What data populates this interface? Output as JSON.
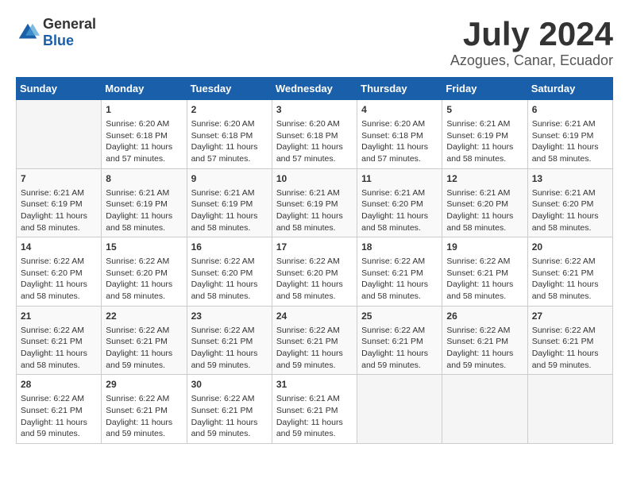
{
  "header": {
    "logo_general": "General",
    "logo_blue": "Blue",
    "month_year": "July 2024",
    "location": "Azogues, Canar, Ecuador"
  },
  "calendar": {
    "days_of_week": [
      "Sunday",
      "Monday",
      "Tuesday",
      "Wednesday",
      "Thursday",
      "Friday",
      "Saturday"
    ],
    "weeks": [
      [
        {
          "day": "",
          "info": ""
        },
        {
          "day": "1",
          "info": "Sunrise: 6:20 AM\nSunset: 6:18 PM\nDaylight: 11 hours\nand 57 minutes."
        },
        {
          "day": "2",
          "info": "Sunrise: 6:20 AM\nSunset: 6:18 PM\nDaylight: 11 hours\nand 57 minutes."
        },
        {
          "day": "3",
          "info": "Sunrise: 6:20 AM\nSunset: 6:18 PM\nDaylight: 11 hours\nand 57 minutes."
        },
        {
          "day": "4",
          "info": "Sunrise: 6:20 AM\nSunset: 6:18 PM\nDaylight: 11 hours\nand 57 minutes."
        },
        {
          "day": "5",
          "info": "Sunrise: 6:21 AM\nSunset: 6:19 PM\nDaylight: 11 hours\nand 58 minutes."
        },
        {
          "day": "6",
          "info": "Sunrise: 6:21 AM\nSunset: 6:19 PM\nDaylight: 11 hours\nand 58 minutes."
        }
      ],
      [
        {
          "day": "7",
          "info": "Sunrise: 6:21 AM\nSunset: 6:19 PM\nDaylight: 11 hours\nand 58 minutes."
        },
        {
          "day": "8",
          "info": "Sunrise: 6:21 AM\nSunset: 6:19 PM\nDaylight: 11 hours\nand 58 minutes."
        },
        {
          "day": "9",
          "info": "Sunrise: 6:21 AM\nSunset: 6:19 PM\nDaylight: 11 hours\nand 58 minutes."
        },
        {
          "day": "10",
          "info": "Sunrise: 6:21 AM\nSunset: 6:19 PM\nDaylight: 11 hours\nand 58 minutes."
        },
        {
          "day": "11",
          "info": "Sunrise: 6:21 AM\nSunset: 6:20 PM\nDaylight: 11 hours\nand 58 minutes."
        },
        {
          "day": "12",
          "info": "Sunrise: 6:21 AM\nSunset: 6:20 PM\nDaylight: 11 hours\nand 58 minutes."
        },
        {
          "day": "13",
          "info": "Sunrise: 6:21 AM\nSunset: 6:20 PM\nDaylight: 11 hours\nand 58 minutes."
        }
      ],
      [
        {
          "day": "14",
          "info": "Sunrise: 6:22 AM\nSunset: 6:20 PM\nDaylight: 11 hours\nand 58 minutes."
        },
        {
          "day": "15",
          "info": "Sunrise: 6:22 AM\nSunset: 6:20 PM\nDaylight: 11 hours\nand 58 minutes."
        },
        {
          "day": "16",
          "info": "Sunrise: 6:22 AM\nSunset: 6:20 PM\nDaylight: 11 hours\nand 58 minutes."
        },
        {
          "day": "17",
          "info": "Sunrise: 6:22 AM\nSunset: 6:20 PM\nDaylight: 11 hours\nand 58 minutes."
        },
        {
          "day": "18",
          "info": "Sunrise: 6:22 AM\nSunset: 6:21 PM\nDaylight: 11 hours\nand 58 minutes."
        },
        {
          "day": "19",
          "info": "Sunrise: 6:22 AM\nSunset: 6:21 PM\nDaylight: 11 hours\nand 58 minutes."
        },
        {
          "day": "20",
          "info": "Sunrise: 6:22 AM\nSunset: 6:21 PM\nDaylight: 11 hours\nand 58 minutes."
        }
      ],
      [
        {
          "day": "21",
          "info": "Sunrise: 6:22 AM\nSunset: 6:21 PM\nDaylight: 11 hours\nand 58 minutes."
        },
        {
          "day": "22",
          "info": "Sunrise: 6:22 AM\nSunset: 6:21 PM\nDaylight: 11 hours\nand 59 minutes."
        },
        {
          "day": "23",
          "info": "Sunrise: 6:22 AM\nSunset: 6:21 PM\nDaylight: 11 hours\nand 59 minutes."
        },
        {
          "day": "24",
          "info": "Sunrise: 6:22 AM\nSunset: 6:21 PM\nDaylight: 11 hours\nand 59 minutes."
        },
        {
          "day": "25",
          "info": "Sunrise: 6:22 AM\nSunset: 6:21 PM\nDaylight: 11 hours\nand 59 minutes."
        },
        {
          "day": "26",
          "info": "Sunrise: 6:22 AM\nSunset: 6:21 PM\nDaylight: 11 hours\nand 59 minutes."
        },
        {
          "day": "27",
          "info": "Sunrise: 6:22 AM\nSunset: 6:21 PM\nDaylight: 11 hours\nand 59 minutes."
        }
      ],
      [
        {
          "day": "28",
          "info": "Sunrise: 6:22 AM\nSunset: 6:21 PM\nDaylight: 11 hours\nand 59 minutes."
        },
        {
          "day": "29",
          "info": "Sunrise: 6:22 AM\nSunset: 6:21 PM\nDaylight: 11 hours\nand 59 minutes."
        },
        {
          "day": "30",
          "info": "Sunrise: 6:22 AM\nSunset: 6:21 PM\nDaylight: 11 hours\nand 59 minutes."
        },
        {
          "day": "31",
          "info": "Sunrise: 6:21 AM\nSunset: 6:21 PM\nDaylight: 11 hours\nand 59 minutes."
        },
        {
          "day": "",
          "info": ""
        },
        {
          "day": "",
          "info": ""
        },
        {
          "day": "",
          "info": ""
        }
      ]
    ]
  }
}
